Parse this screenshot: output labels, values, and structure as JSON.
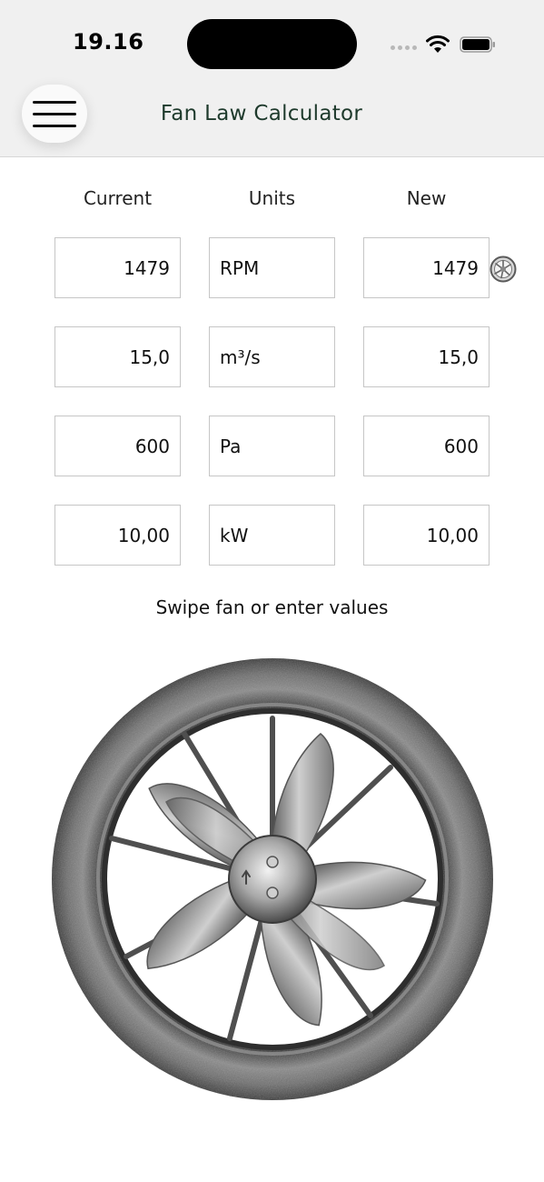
{
  "status_bar": {
    "time": "19.16"
  },
  "header": {
    "title": "Fan Law Calculator"
  },
  "table": {
    "columns": {
      "current": "Current",
      "units": "Units",
      "new": "New"
    },
    "rows": [
      {
        "current": "1479",
        "unit": "RPM",
        "new": "1479"
      },
      {
        "current": "15,0",
        "unit": "m³/s",
        "new": "15,0"
      },
      {
        "current": "600",
        "unit": "Pa",
        "new": "600"
      },
      {
        "current": "10,00",
        "unit": "kW",
        "new": "10,00"
      }
    ]
  },
  "hint": "Swipe fan or enter values",
  "icons": {
    "menu": "hamburger-menu-icon",
    "fan": "fan-icon",
    "wifi": "wifi-icon",
    "battery": "battery-icon"
  },
  "colors": {
    "title": "#1e3a2c",
    "bar_background": "#f0f0f0",
    "field_border": "#c6c6c6"
  }
}
